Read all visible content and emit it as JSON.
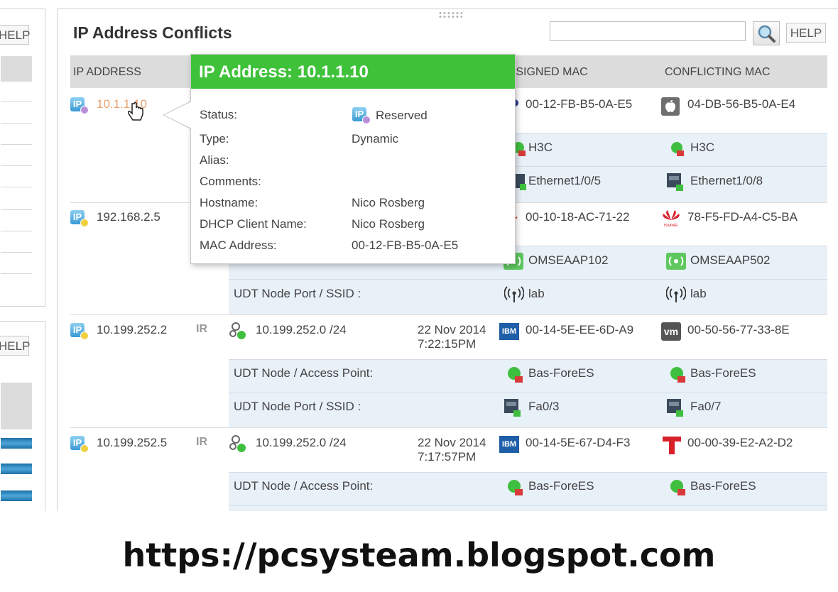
{
  "left": {
    "help_top": "HELP",
    "help_bottom": "HELP"
  },
  "panel": {
    "title": "IP Address Conflicts",
    "search_placeholder": "",
    "help": "HELP"
  },
  "columns": [
    "IP ADDRESS",
    "ASSIGNED MAC",
    "CONFLICTING MAC"
  ],
  "tooltip": {
    "title": "IP Address: 10.1.1.10",
    "fields": [
      {
        "label": "Status:",
        "value": "Reserved"
      },
      {
        "label": "Type:",
        "value": "Dynamic"
      },
      {
        "label": "Alias:",
        "value": ""
      },
      {
        "label": "Comments:",
        "value": ""
      },
      {
        "label": "Hostname:",
        "value": "Nico Rosberg"
      },
      {
        "label": "DHCP Client Name:",
        "value": "Nico Rosberg"
      },
      {
        "label": "MAC Address:",
        "value": "00-12-FB-B5-0A-E5"
      }
    ]
  },
  "rows": [
    {
      "ip": "10.1.1.10",
      "assigned_mac": "00-12-FB-B5-0A-E5",
      "conflicting_mac": "04-DB-56-B5-0A-E4",
      "node_a": "H3C",
      "node_b": "H3C",
      "port_a": "Ethernet1/0/5",
      "port_b": "Ethernet1/0/8"
    },
    {
      "ip": "192.168.2.5",
      "assigned_mac": "00-10-18-AC-71-22",
      "conflicting_mac": "78-F5-FD-A4-C5-BA",
      "node_a": "OMSEAAP102",
      "node_b": "OMSEAAP502",
      "port_label": "UDT Node Port / SSID :",
      "port_a": "lab",
      "port_b": "lab"
    },
    {
      "ip": "10.199.252.2",
      "subnet": "10.199.252.0 /24",
      "date": "22 Nov 2014",
      "time": "7:22:15PM",
      "assigned_mac": "00-14-5E-EE-6D-A9",
      "conflicting_mac": "00-50-56-77-33-8E",
      "node_label": "UDT Node / Access Point:",
      "node_a": "Bas-ForeES",
      "node_b": "Bas-ForeES",
      "port_label": "UDT Node Port / SSID :",
      "port_a": "Fa0/3",
      "port_b": "Fa0/7"
    },
    {
      "ip": "10.199.252.5",
      "subnet": "10.199.252.0 /24",
      "date": "22 Nov 2014",
      "time": "7:17:57PM",
      "assigned_mac": "00-14-5E-67-D4-F3",
      "conflicting_mac": "00-00-39-E2-A2-D2",
      "node_label": "UDT Node / Access Point:",
      "node_a": "Bas-ForeES",
      "node_b": "Bas-ForeES"
    }
  ],
  "vendor_labels": {
    "ibm": "IBM",
    "vm": "vm",
    "huawei": "HUAWEI",
    "ip": "IP",
    "ir": "IR"
  },
  "footer": "https://pcsysteam.blogspot.com",
  "colors": {
    "tooltip_header": "#3fc23a",
    "row_highlight": "#e8f0f8",
    "link_orange": "#e8a070"
  }
}
